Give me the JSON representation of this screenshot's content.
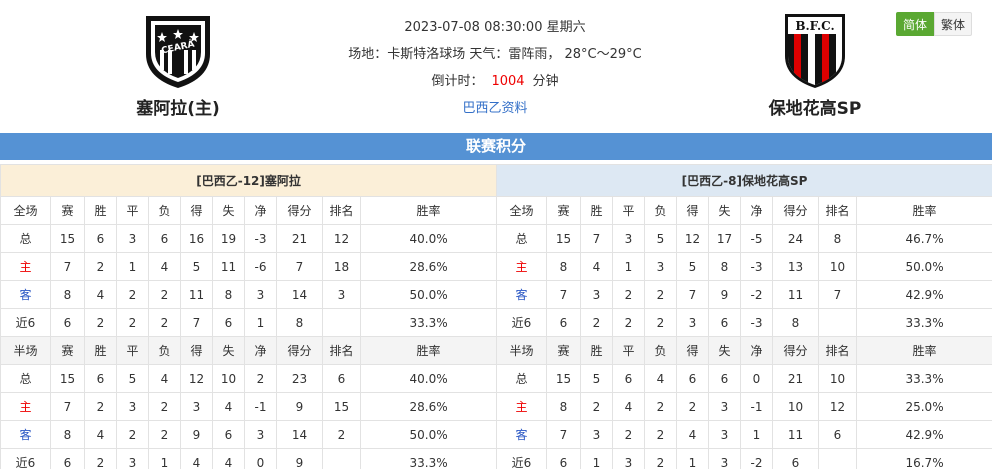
{
  "match": {
    "datetime": "2023-07-08 08:30:00 星期六",
    "venue_weather": "场地：卡斯特洛球场 天气：雷阵雨， 28°C～29°C",
    "countdown_label": "倒计时：",
    "countdown_value": "1004",
    "countdown_unit": "分钟",
    "league_link": "巴西乙资料"
  },
  "home_team": {
    "name": "塞阿拉(主)",
    "logo_text": "CEARÁ"
  },
  "away_team": {
    "name": "保地花高SP",
    "logo_text": "B.F.C."
  },
  "lang": {
    "simplified": "简体",
    "traditional": "繁体"
  },
  "section_title": "联赛积分",
  "colors": {
    "header_bar": "#5592d4",
    "home_title_bg": "#fbefd8",
    "away_title_bg": "#dde8f3",
    "lang_active": "#5aa832",
    "home_label": "#e00000",
    "away_label": "#2a57c4",
    "countdown": "#e00000"
  },
  "standings": {
    "left": {
      "title": "[巴西乙-12]塞阿拉",
      "full_headers": [
        "全场",
        "赛",
        "胜",
        "平",
        "负",
        "得",
        "失",
        "净",
        "得分",
        "排名",
        "胜率"
      ],
      "full_rows": [
        [
          "总",
          "15",
          "6",
          "3",
          "6",
          "16",
          "19",
          "-3",
          "21",
          "12",
          "40.0%"
        ],
        [
          "主",
          "7",
          "2",
          "1",
          "4",
          "5",
          "11",
          "-6",
          "7",
          "18",
          "28.6%"
        ],
        [
          "客",
          "8",
          "4",
          "2",
          "2",
          "11",
          "8",
          "3",
          "14",
          "3",
          "50.0%"
        ],
        [
          "近6",
          "6",
          "2",
          "2",
          "2",
          "7",
          "6",
          "1",
          "8",
          "",
          "33.3%"
        ]
      ],
      "half_headers": [
        "半场",
        "赛",
        "胜",
        "平",
        "负",
        "得",
        "失",
        "净",
        "得分",
        "排名",
        "胜率"
      ],
      "half_rows": [
        [
          "总",
          "15",
          "6",
          "5",
          "4",
          "12",
          "10",
          "2",
          "23",
          "6",
          "40.0%"
        ],
        [
          "主",
          "7",
          "2",
          "3",
          "2",
          "3",
          "4",
          "-1",
          "9",
          "15",
          "28.6%"
        ],
        [
          "客",
          "8",
          "4",
          "2",
          "2",
          "9",
          "6",
          "3",
          "14",
          "2",
          "50.0%"
        ],
        [
          "近6",
          "6",
          "2",
          "3",
          "1",
          "4",
          "4",
          "0",
          "9",
          "",
          "33.3%"
        ]
      ]
    },
    "right": {
      "title": "[巴西乙-8]保地花高SP",
      "full_headers": [
        "全场",
        "赛",
        "胜",
        "平",
        "负",
        "得",
        "失",
        "净",
        "得分",
        "排名",
        "胜率"
      ],
      "full_rows": [
        [
          "总",
          "15",
          "7",
          "3",
          "5",
          "12",
          "17",
          "-5",
          "24",
          "8",
          "46.7%"
        ],
        [
          "主",
          "8",
          "4",
          "1",
          "3",
          "5",
          "8",
          "-3",
          "13",
          "10",
          "50.0%"
        ],
        [
          "客",
          "7",
          "3",
          "2",
          "2",
          "7",
          "9",
          "-2",
          "11",
          "7",
          "42.9%"
        ],
        [
          "近6",
          "6",
          "2",
          "2",
          "2",
          "3",
          "6",
          "-3",
          "8",
          "",
          "33.3%"
        ]
      ],
      "half_headers": [
        "半场",
        "赛",
        "胜",
        "平",
        "负",
        "得",
        "失",
        "净",
        "得分",
        "排名",
        "胜率"
      ],
      "half_rows": [
        [
          "总",
          "15",
          "5",
          "6",
          "4",
          "6",
          "6",
          "0",
          "21",
          "10",
          "33.3%"
        ],
        [
          "主",
          "8",
          "2",
          "4",
          "2",
          "2",
          "3",
          "-1",
          "10",
          "12",
          "25.0%"
        ],
        [
          "客",
          "7",
          "3",
          "2",
          "2",
          "4",
          "3",
          "1",
          "11",
          "6",
          "42.9%"
        ],
        [
          "近6",
          "6",
          "1",
          "3",
          "2",
          "1",
          "3",
          "-2",
          "6",
          "",
          "16.7%"
        ]
      ]
    }
  }
}
